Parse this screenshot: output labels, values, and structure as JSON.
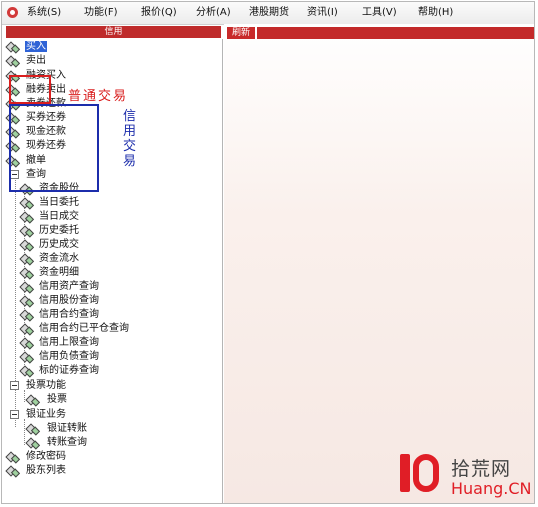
{
  "menubar": {
    "items": [
      "系统(S)",
      "功能(F)",
      "报价(Q)",
      "分析(A)",
      "港股期货",
      "资讯(I)",
      "工具(V)",
      "帮助(H)"
    ]
  },
  "left_panel": {
    "header": "信用",
    "items": [
      "买入",
      "卖出",
      "融资买入",
      "融券卖出",
      "卖券还款",
      "买券还券",
      "现金还款",
      "现券还券",
      "撤单",
      "查询",
      "资金股份",
      "当日委托",
      "当日成交",
      "历史委托",
      "历史成交",
      "资金流水",
      "资金明细",
      "信用资产查询",
      "信用股份查询",
      "信用合约查询",
      "信用合约已平仓查询",
      "信用上限查询",
      "信用负债查询",
      "标的证券查询",
      "投票功能",
      "投票",
      "银证业务",
      "银证转账",
      "转账查询",
      "修改密码",
      "股东列表"
    ]
  },
  "annotations": {
    "normal_trade": "普通交易",
    "credit_trade": "信用交易"
  },
  "right_panel": {
    "refresh_label": "刷新"
  },
  "watermark": {
    "cn": "拾荒网",
    "en": "Huang.CN"
  },
  "colors": {
    "accent_red": "#c32a2a",
    "selection_blue": "#2f63d6",
    "annotation_red": "#d91e1e",
    "annotation_blue": "#1c2dab"
  }
}
